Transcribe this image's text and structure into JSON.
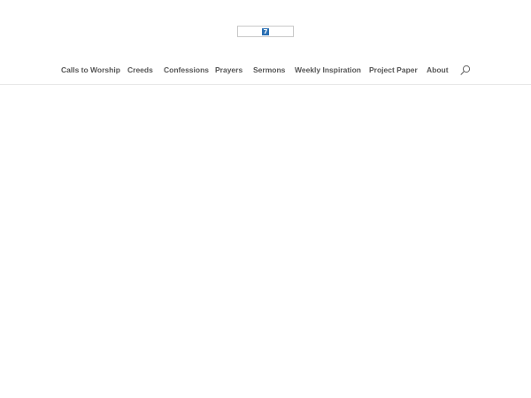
{
  "header": {
    "logo": {
      "mark": "7"
    },
    "nav": [
      {
        "label": "Calls to Worship"
      },
      {
        "label": "Creeds"
      },
      {
        "label": "Confessions"
      },
      {
        "label": "Prayers"
      },
      {
        "label": "Sermons"
      },
      {
        "label": "Weekly Inspiration"
      },
      {
        "label": "Project Paper"
      },
      {
        "label": "About"
      }
    ],
    "search_icon": "search-icon"
  },
  "colors": {
    "nav_text": "#555555",
    "logo_accent": "#2a6fb3",
    "divider": "#e8e8e8"
  }
}
